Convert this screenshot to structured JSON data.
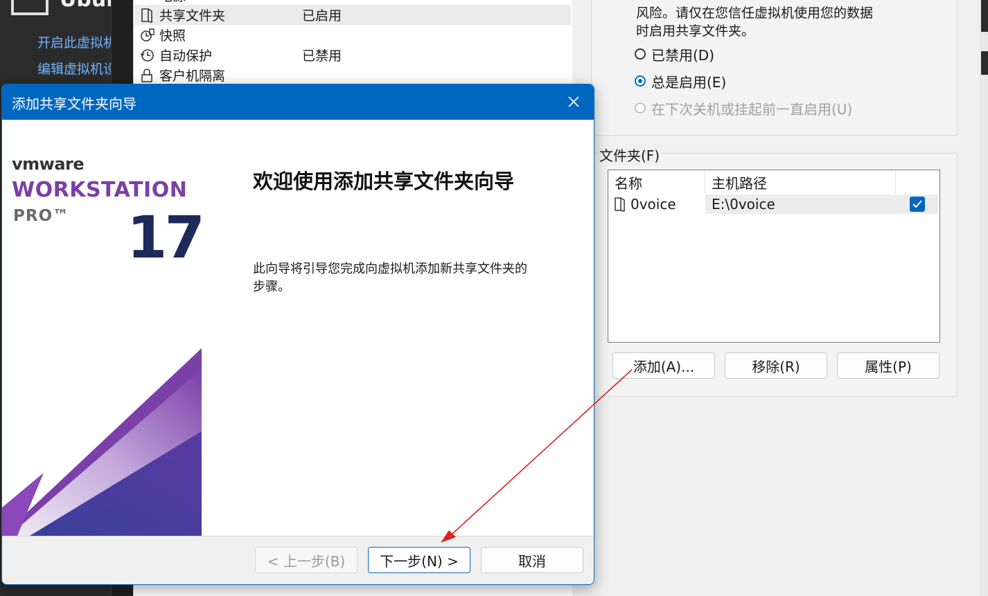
{
  "vm_library": {
    "vm_name": "Ubuntu",
    "actions": [
      {
        "label": "开启此虚拟机"
      },
      {
        "label": "编辑虚拟机设置"
      }
    ]
  },
  "device_list": {
    "items": [
      {
        "name": "电源",
        "value": ""
      },
      {
        "name": "共享文件夹",
        "value": "已启用"
      },
      {
        "name": "快照",
        "value": ""
      },
      {
        "name": "自动保护",
        "value": "已禁用"
      },
      {
        "name": "客户机隔离",
        "value": ""
      }
    ]
  },
  "shared_folders": {
    "warning_line_1": "风险。请仅在您信任虚拟机使用您的数据",
    "warning_line_2": "时启用共享文件夹。",
    "radio_disabled": "已禁用(D)",
    "radio_always": "总是启用(E)",
    "radio_until_off": "在下次关机或挂起前一直启用(U)",
    "folders_legend": "文件夹(F)",
    "col_name": "名称",
    "col_path": "主机路径",
    "rows": [
      {
        "name": "0voice",
        "path": "E:\\0voice",
        "enabled": true
      }
    ],
    "btn_add": "添加(A)...",
    "btn_remove": "移除(R)",
    "btn_props": "属性(P)"
  },
  "wizard": {
    "title": "添加共享文件夹向导",
    "brand_vmware": "vmware",
    "brand_product": "WORKSTATION",
    "brand_edition": "PRO™",
    "brand_version": "17",
    "heading": "欢迎使用添加共享文件夹向导",
    "description": "此向导将引导您完成向虚拟机添加新共享文件夹的步骤。",
    "btn_back": "< 上一步(B)",
    "btn_next": "下一步(N) >",
    "btn_cancel": "取消"
  },
  "colors": {
    "accent": "#0067c0",
    "brand_purple": "#7b3fa8",
    "annotation_arrow": "#e02020"
  }
}
